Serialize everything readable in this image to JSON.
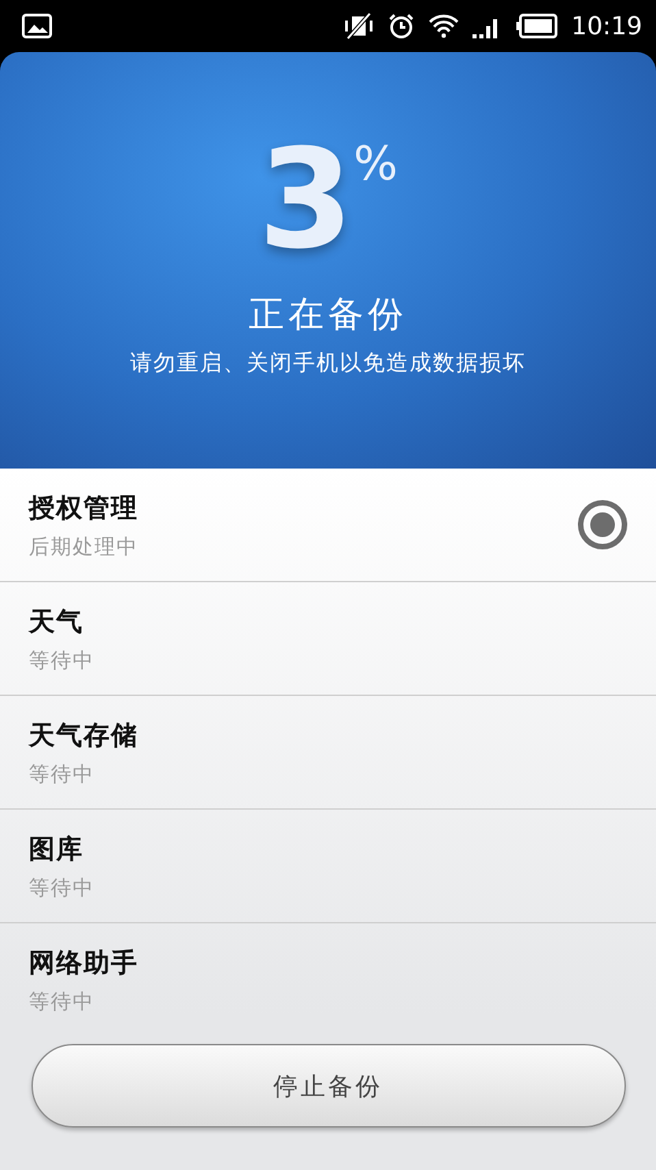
{
  "status_bar": {
    "time": "10:19"
  },
  "progress": {
    "value": "3",
    "unit": "%",
    "title": "正在备份",
    "warning": "请勿重启、关闭手机以免造成数据损坏"
  },
  "items": [
    {
      "name": "授权管理",
      "status": "后期处理中",
      "active": true
    },
    {
      "name": "天气",
      "status": "等待中",
      "active": false
    },
    {
      "name": "天气存储",
      "status": "等待中",
      "active": false
    },
    {
      "name": "图库",
      "status": "等待中",
      "active": false
    },
    {
      "name": "网络助手",
      "status": "等待中",
      "active": false
    }
  ],
  "stop_button": "停止备份"
}
